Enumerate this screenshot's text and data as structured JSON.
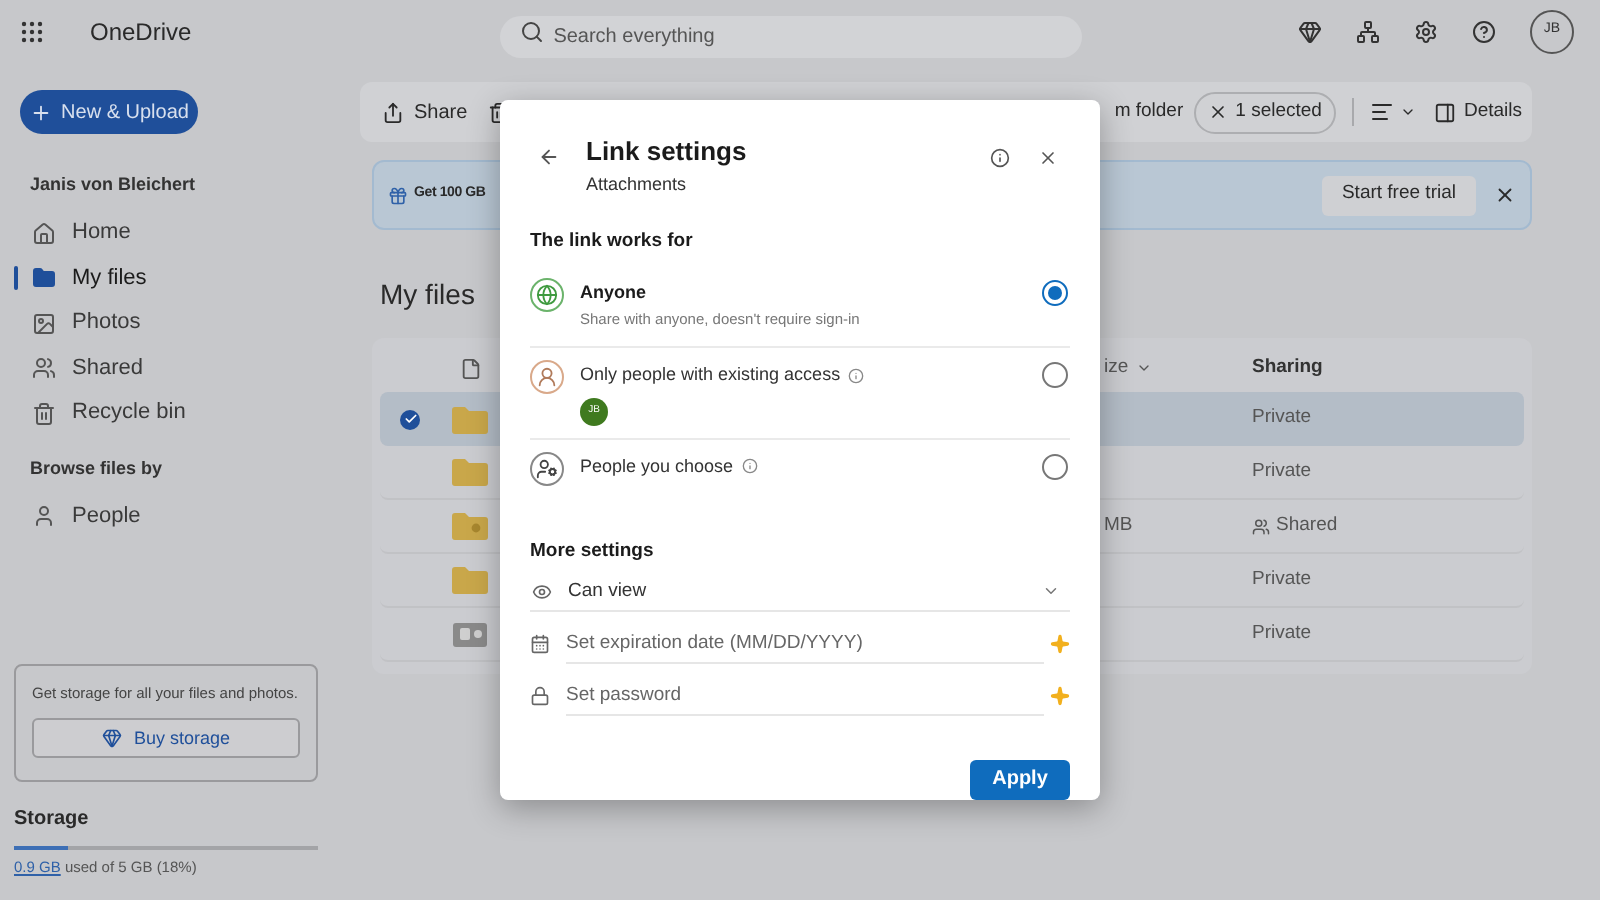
{
  "header": {
    "app_name": "OneDrive",
    "search": {
      "placeholder": "Search everything"
    },
    "avatar": "JB"
  },
  "sidebar": {
    "new_button": "New & Upload",
    "user_name": "Janis von Bleichert",
    "items": [
      {
        "label": "Home",
        "selected": false
      },
      {
        "label": "My files",
        "selected": true
      },
      {
        "label": "Photos",
        "selected": false
      },
      {
        "label": "Shared",
        "selected": false
      },
      {
        "label": "Recycle bin",
        "selected": false
      }
    ],
    "browse_heading": "Browse files by",
    "browse_items": [
      {
        "label": "People",
        "selected": false
      }
    ],
    "promo": {
      "text": "Get storage for all your files and photos.",
      "button": "Buy storage"
    },
    "storage": {
      "title": "Storage",
      "used": "0.9 GB",
      "rest": "used of 5 GB (18%)",
      "level": 0.18
    }
  },
  "toolbar": {
    "share": "Share",
    "folder_fragment": "m folder",
    "selection": "1 selected",
    "details": "Details"
  },
  "banner": {
    "text": "Get 100 GB",
    "button": "Start free trial"
  },
  "page_title": "My files",
  "table": {
    "columns": {
      "size": "ize",
      "sharing": "Sharing"
    },
    "rows": [
      {
        "kind": "folder",
        "selected": true,
        "sharing": "Private",
        "shared": false
      },
      {
        "kind": "folder",
        "selected": false,
        "sharing": "Private",
        "shared": false
      },
      {
        "kind": "shared-folder",
        "selected": false,
        "size": "MB",
        "sharing": "Shared",
        "shared": true
      },
      {
        "kind": "folder",
        "selected": false,
        "sharing": "Private",
        "shared": false
      },
      {
        "kind": "album",
        "selected": false,
        "sharing": "Private",
        "shared": false
      }
    ]
  },
  "dialog": {
    "title": "Link settings",
    "subtitle": "Attachments",
    "section": "The link works for",
    "options": [
      {
        "kind": "globe",
        "label": "Anyone",
        "description": "Share with anyone, doesn't require sign-in",
        "info": false,
        "selected": true
      },
      {
        "kind": "existing",
        "label": "Only people with existing access",
        "info": true,
        "avatar": "JB",
        "selected": false
      },
      {
        "kind": "choose",
        "label": "People you choose",
        "info": true,
        "selected": false
      }
    ],
    "more_heading": "More settings",
    "permission": "Can view",
    "expiration": {
      "placeholder": "Set expiration date (MM/DD/YYYY)"
    },
    "password": {
      "placeholder": "Set password"
    },
    "apply": "Apply"
  }
}
